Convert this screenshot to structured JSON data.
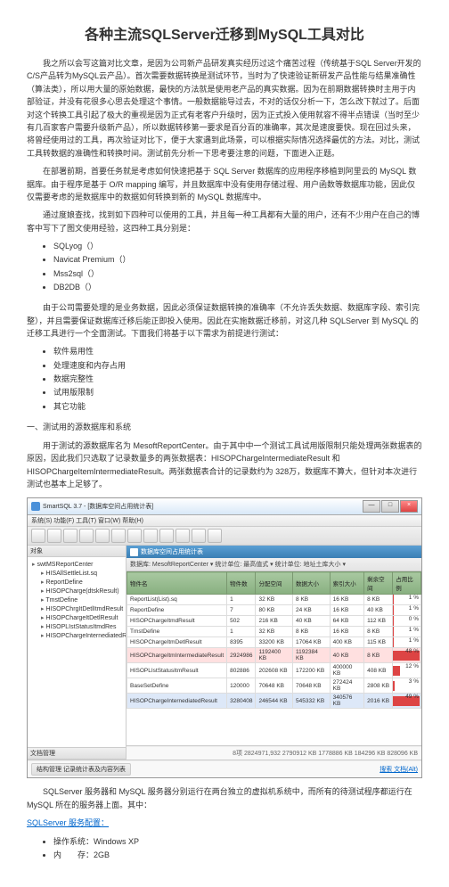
{
  "title": "各种主流SQLServer迁移到MySQL工具对比",
  "para1": "我之所以会写这篇对比文章，是因为公司新产品研发真实经历过这个痛苦过程（传统基于SQL Server开发的C/S产品转为MySQL云产品）。首次需要数据转换是测试环节，当时为了快速验证新研发产品性能与结果准确性（算法类），所以用大量的原始数据，最快的方法就是使用老产品的真实数据。因为在前期数据转换时主用于内部验证，并没有花很多心思去处理这个事情。一般数据能导过去，不对的话仅分析一下，怎么改下就过了。后面对这个转换工具引起了极大的重视是因为正式有老客户升级时，因为正式投入使用就容不得半点错误（当时至少有几百家客户需要升级新产品），所以数据转移第一要求是百分百的准确率，其次是速度要快。现在回过头来，将曾经使用过的工具，再次验证对比下，便于大家遇到此场景，可以根据实际情况选择最优的方法。对比，测试工具转数据的准确性和转换时间。测试前先分析一下思考要注意的问题，下面进入正题。",
  "para2": "在部署前期，首要任务就是考虑如何快速把基于 SQL Server 数据库的应用程序移植到阿里云的 MySQL 数据库。由于程序是基于 O/R mapping 编写，并且数据库中没有使用存储过程、用户函数等数据库功能，因此仅仅需要考虑的是数据库中的数据如何转换到新的 MySQL 数据库中。",
  "para3": "通过度娘查找，找到如下四种可以使用的工具，并且每一种工具都有大量的用户，还有不少用户在自己的博客中写下了图文使用经验，这四种工具分别是：",
  "tools": [
    "SQLyog（）",
    "Navicat Premium（）",
    "Mss2sql（）",
    "DB2DB（）"
  ],
  "para4": "由于公司需要处理的是业务数据，因此必须保证数据转换的准确率（不允许丢失数据、数据库字段、索引完整），并且需要保证数据库迁移后能正即投入使用。因此在实施数据迁移前，对这几种 SQLServer 到 MySQL 的迁移工具进行一个全面测试。下面我们将基于以下需求为前提进行测试：",
  "reqs": [
    "软件易用性",
    "处理速度和内存占用",
    "数据完整性",
    "试用版限制",
    "其它功能"
  ],
  "sec1": "一、测试用的源数据库和系统",
  "para5_a": "用于测试的源数据库名为 MesoftReportCenter。由于其中中一个测试工具试用版限制只能处理两张数据表的原因，因此我们只选取了记录数量多的两张数据表：HISOPChargeIntermediateResult 和 HISOPChargeItemIntermediateResult。两张数据表合计的记录数约为 328万，数据库不算大，但针对本次进行测试也基本上足够了。",
  "app": {
    "title": "SmartSQL 3.7 - [数据库空间占用统计表]",
    "menu": "系统(S)  功能(F)  工具(T)  窗口(W)  帮助(H)",
    "left_header": "对象",
    "root": "swtMSReportCenter",
    "tree": [
      "HISAllSettleList.sq",
      "ReportDefine",
      "HISOPCharge(dtskResult)",
      "TmstDefine",
      "HISOPChrgItDetlItmdResult",
      "HISOPChargeItDetlResult",
      "HISOPLIstStatusItmdRes",
      "HISOPChargeInternediatedResult"
    ],
    "tab": "数据库空间占用统计表",
    "sub_toolbar": "数据库: MesoftReportCenter ▾  统计单位: 最高值式 ▾  统计单位: 地址土库大小 ▾",
    "cols": [
      "物件名",
      "物件数",
      "分配空间",
      "数据大小",
      "索引大小",
      "剩余空间",
      "占用比例"
    ],
    "rows": [
      {
        "c": [
          "ReportList(List).sq",
          "1",
          "32 KB",
          "8 KB",
          "16 KB",
          "8 KB",
          "1 %"
        ],
        "bar": 1
      },
      {
        "c": [
          "ReportDefine",
          "7",
          "80 KB",
          "24 KB",
          "16 KB",
          "40 KB",
          "1 %"
        ],
        "bar": 1
      },
      {
        "c": [
          "HISOPChargeItmdResult",
          "502",
          "216 KB",
          "40 KB",
          "64 KB",
          "112 KB",
          "0 %"
        ],
        "bar": 0.5
      },
      {
        "c": [
          "TmstDefine",
          "1",
          "32 KB",
          "8 KB",
          "16 KB",
          "8 KB",
          "1 %"
        ],
        "bar": 1
      },
      {
        "c": [
          "HISOPChargeItmDetlResult",
          "8395",
          "33200 KB",
          "17064 KB",
          "400 KB",
          "115 KB",
          "1 %"
        ],
        "bar": 1
      },
      {
        "c": [
          "HISOPChargeItmIntermediateResult",
          "2924986",
          "1192400 KB",
          "1192384 KB",
          "40 KB",
          "8 KB",
          "48 %"
        ],
        "bar": 48,
        "hl": true
      },
      {
        "c": [
          "HISOPLIstStatusItmResult",
          "802886",
          "202608 KB",
          "172200 KB",
          "400000 KB",
          "408 KB",
          "12 %"
        ],
        "bar": 12
      },
      {
        "c": [
          "BaseSetDefine",
          "120000",
          "70648 KB",
          "70648 KB",
          "272424 KB",
          "2808 KB",
          "3 %"
        ],
        "bar": 3
      },
      {
        "c": [
          "HISOPChargeInternediatedResult",
          "3280408",
          "246544 KB",
          "545332 KB",
          "340576 KB",
          "2016 KB",
          "49 %"
        ],
        "bar": 49,
        "sel": true
      }
    ],
    "status_left": "文档管理",
    "status_btn": "结构管理  记录统计表及内容列表",
    "status_right": "8项    2824971,932    2790912 KB    1778886 KB    184296 KB    828096 KB",
    "footer_btn": "搜索  文档(Alt)"
  },
  "para6": "SQLServer 服务器和 MySQL 服务器分别运行在两台独立的虚拟机系统中，而所有的待测试程序都运行在 MySQL 所在的服务器上面。其中：",
  "cfg_title": "SQLServer 服务配置：",
  "cfg": [
    "操作系统：Windows XP",
    "内　　存：2GB"
  ]
}
